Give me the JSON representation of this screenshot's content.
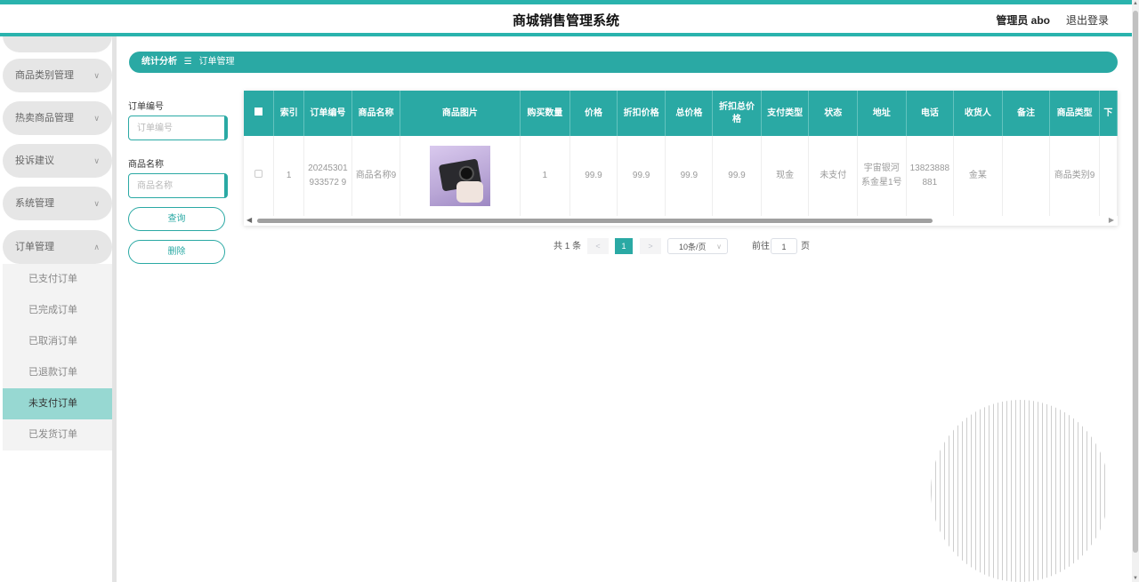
{
  "header": {
    "title": "商城销售管理系统",
    "admin": "管理员 abo",
    "logout": "退出登录"
  },
  "sidebar": {
    "items": [
      {
        "label": "",
        "chevron": "∨"
      },
      {
        "label": "商品类别管理",
        "chevron": "∨"
      },
      {
        "label": "热卖商品管理",
        "chevron": "∨"
      },
      {
        "label": "投诉建议",
        "chevron": "∨"
      },
      {
        "label": "系统管理",
        "chevron": "∨"
      },
      {
        "label": "订单管理",
        "chevron": "∧"
      }
    ],
    "sub_items": [
      {
        "label": "已支付订单"
      },
      {
        "label": "已完成订单"
      },
      {
        "label": "已取消订单"
      },
      {
        "label": "已退款订单"
      },
      {
        "label": "未支付订单"
      },
      {
        "label": "已发货订单"
      }
    ]
  },
  "breadcrumb": {
    "first": "统计分析",
    "separator": "☰",
    "second": "订单管理"
  },
  "filters": {
    "order_no_label": "订单编号",
    "order_no_placeholder": "订单编号",
    "product_name_label": "商品名称",
    "product_name_placeholder": "商品名称",
    "search_button": "查询",
    "delete_button": "删除"
  },
  "table": {
    "headers": [
      "索引",
      "订单编号",
      "商品名称",
      "商品图片",
      "购买数量",
      "价格",
      "折扣价格",
      "总价格",
      "折扣总价格",
      "支付类型",
      "状态",
      "地址",
      "电话",
      "收货人",
      "备注",
      "商品类型",
      "下"
    ],
    "rows": [
      {
        "index": "1",
        "order_no": "20245301933572 9",
        "product_name": "商品名称9",
        "quantity": "1",
        "price": "99.9",
        "discount_price": "99.9",
        "total_price": "99.9",
        "discount_total": "99.9",
        "payment_type": "现金",
        "status": "未支付",
        "address": "宇宙银河系金星1号",
        "phone": "13823888881",
        "receiver": "金某",
        "remark": "",
        "product_type": "商品类别9",
        "last": ""
      }
    ]
  },
  "pagination": {
    "total": "共 1 条",
    "prev": "<",
    "current": "1",
    "next": ">",
    "page_size": "10条/页",
    "goto_label": "前往",
    "goto_value": "1",
    "page_suffix": "页"
  },
  "colors": {
    "accent": "#2aa9a4",
    "active_sub": "#97d8d2"
  }
}
